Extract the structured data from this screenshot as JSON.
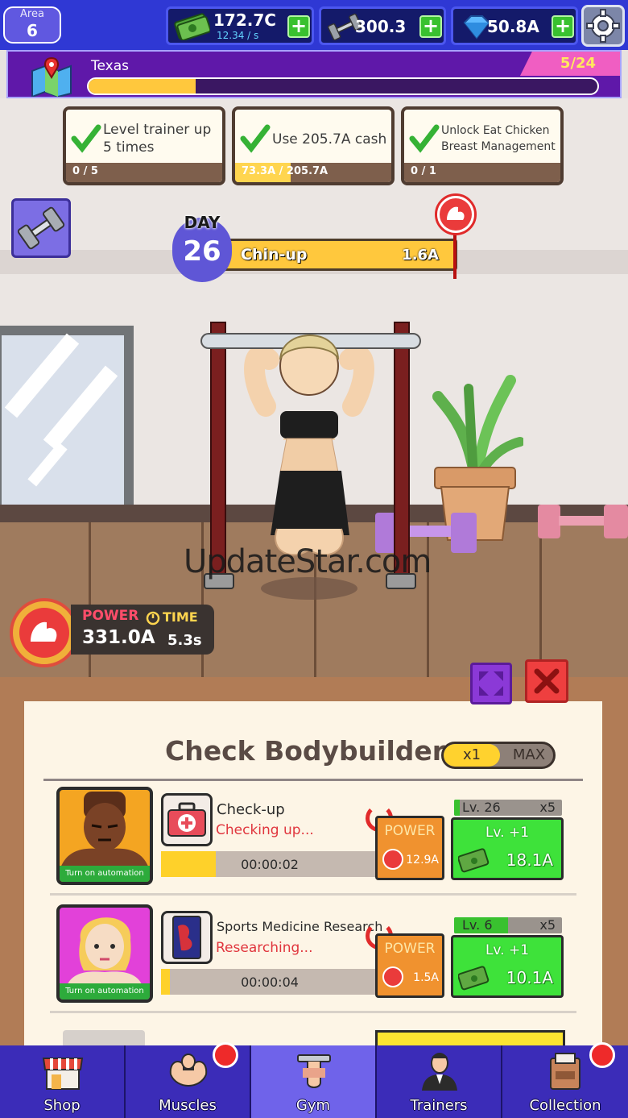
{
  "topbar": {
    "area_label": "Area",
    "area_value": "6",
    "cash": "172.7C",
    "cash_rate": "12.34 / s",
    "dumbbells": "300.3",
    "gems": "50.8A"
  },
  "area_progress": {
    "region": "Texas",
    "count": "5/24",
    "fraction": 0.21
  },
  "quests": [
    {
      "text": "Level trainer up 5 times",
      "progress": "0 / 5",
      "fraction": 0
    },
    {
      "text": "Use 205.7A cash",
      "progress": "73.3A / 205.7A",
      "fraction": 0.356
    },
    {
      "text": "Unlock Eat Chicken Breast Management",
      "progress": "0 / 1",
      "fraction": 0
    }
  ],
  "day": {
    "label": "DAY",
    "value": "26",
    "exercise": "Chin-up",
    "exercise_value": "1.6A"
  },
  "stats": {
    "power_label": "POWER",
    "power_value": "331.0A",
    "time_label": "TIME",
    "time_value": "5.3s"
  },
  "watermark": "UpdateStar.com",
  "panel": {
    "title": "Check Bodybuilders",
    "toggle_x1": "x1",
    "toggle_max": "MAX",
    "rows": [
      {
        "automation": "Turn on automation",
        "task": "Check-up",
        "status": "Checking up...",
        "timer": "00:00:02",
        "timer_fraction": 0.25,
        "power_label": "POWER",
        "power_value": "12.9A",
        "level": "Lv. 26",
        "multiplier": "x5",
        "level_fraction": 0.05,
        "upgrade_label": "Lv. +1",
        "upgrade_cost": "18.1A"
      },
      {
        "automation": "Turn on automation",
        "task": "Sports Medicine Research",
        "status": "Researching...",
        "timer": "00:00:04",
        "timer_fraction": 0.04,
        "power_label": "POWER",
        "power_value": "1.5A",
        "level": "Lv. 6",
        "multiplier": "x5",
        "level_fraction": 0.5,
        "upgrade_label": "Lv. +1",
        "upgrade_cost": "10.1A"
      }
    ]
  },
  "nav": [
    {
      "label": "Shop",
      "icon": "shop-icon",
      "badge": false
    },
    {
      "label": "Muscles",
      "icon": "muscle-icon",
      "badge": true
    },
    {
      "label": "Gym",
      "icon": "gym-icon",
      "badge": false,
      "active": true
    },
    {
      "label": "Trainers",
      "icon": "trainer-icon",
      "badge": false
    },
    {
      "label": "Collection",
      "icon": "collection-icon",
      "badge": true
    }
  ],
  "colors": {
    "topbar": "#2f38d4",
    "cash_green": "#39c12f",
    "accent_purple": "#5f18a9",
    "progress_yellow": "#ffc83d",
    "nav_bg": "#3b2cb8",
    "nav_active": "#6f63ea",
    "status_red": "#e0353d"
  }
}
